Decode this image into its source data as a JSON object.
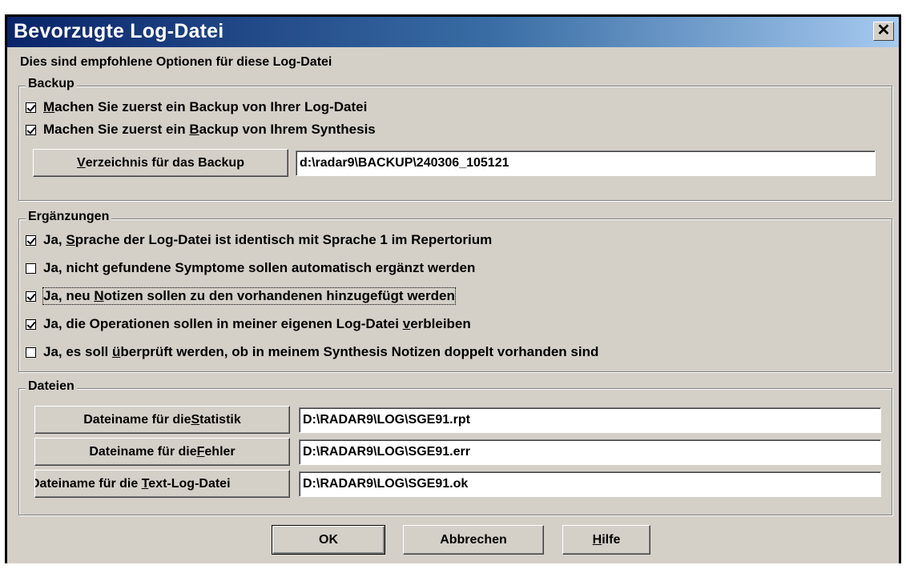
{
  "window": {
    "title": "Bevorzugte Log-Datei",
    "close_label": "✕"
  },
  "intro": "Dies sind empfohlene Optionen für diese Log-Datei",
  "backup": {
    "legend": "Backup",
    "options": [
      {
        "pre": "",
        "u": "M",
        "post": "achen Sie zuerst ein Backup von Ihrer Log-Datei",
        "checked": true
      },
      {
        "pre": "Machen Sie zuerst ein ",
        "u": "B",
        "post": "ackup von Ihrem Synthesis",
        "checked": true
      }
    ],
    "dir_button": {
      "pre": "",
      "u": "V",
      "post": "erzeichnis für das Backup"
    },
    "dir_value": "d:\\radar9\\BACKUP\\240306_105121"
  },
  "ergaenzungen": {
    "legend": "Ergänzungen",
    "options": [
      {
        "pre": "Ja, ",
        "u": "S",
        "post": "prache der Log-Datei ist identisch mit Sprache 1 im Repertorium",
        "checked": true
      },
      {
        "pre": "Ja, nicht ",
        "u": "g",
        "post": "efundene Symptome sollen automatisch ergänzt werden",
        "checked": false
      },
      {
        "pre": "Ja, neu ",
        "u": "N",
        "post": "otizen sollen zu den vorhandenen hinzugefügt werden",
        "checked": true
      },
      {
        "pre": "Ja, die Operationen sollen in meiner eigenen Log-Datei ",
        "u": "v",
        "post": "erbleiben",
        "checked": true
      },
      {
        "pre": "Ja, es soll ",
        "u": "ü",
        "post": "berprüft werden, ob in meinem Synthesis Notizen doppelt vorhanden sind",
        "checked": false
      }
    ]
  },
  "dateien": {
    "legend": "Dateien",
    "rows": [
      {
        "pre": "Dateiname für die ",
        "u": "S",
        "post": "tatistik",
        "value": "D:\\RADAR9\\LOG\\SGE91.rpt"
      },
      {
        "pre": "Dateiname für die ",
        "u": "F",
        "post": "ehler",
        "value": "D:\\RADAR9\\LOG\\SGE91.err"
      },
      {
        "pre": "Dateiname für die ",
        "u": "T",
        "post": "ext-Log-Datei",
        "value": "D:\\RADAR9\\LOG\\SGE91.ok"
      }
    ]
  },
  "buttons": {
    "ok": "OK",
    "cancel": "Abbrechen",
    "help": {
      "pre": "",
      "u": "H",
      "post": "ilfe"
    }
  }
}
